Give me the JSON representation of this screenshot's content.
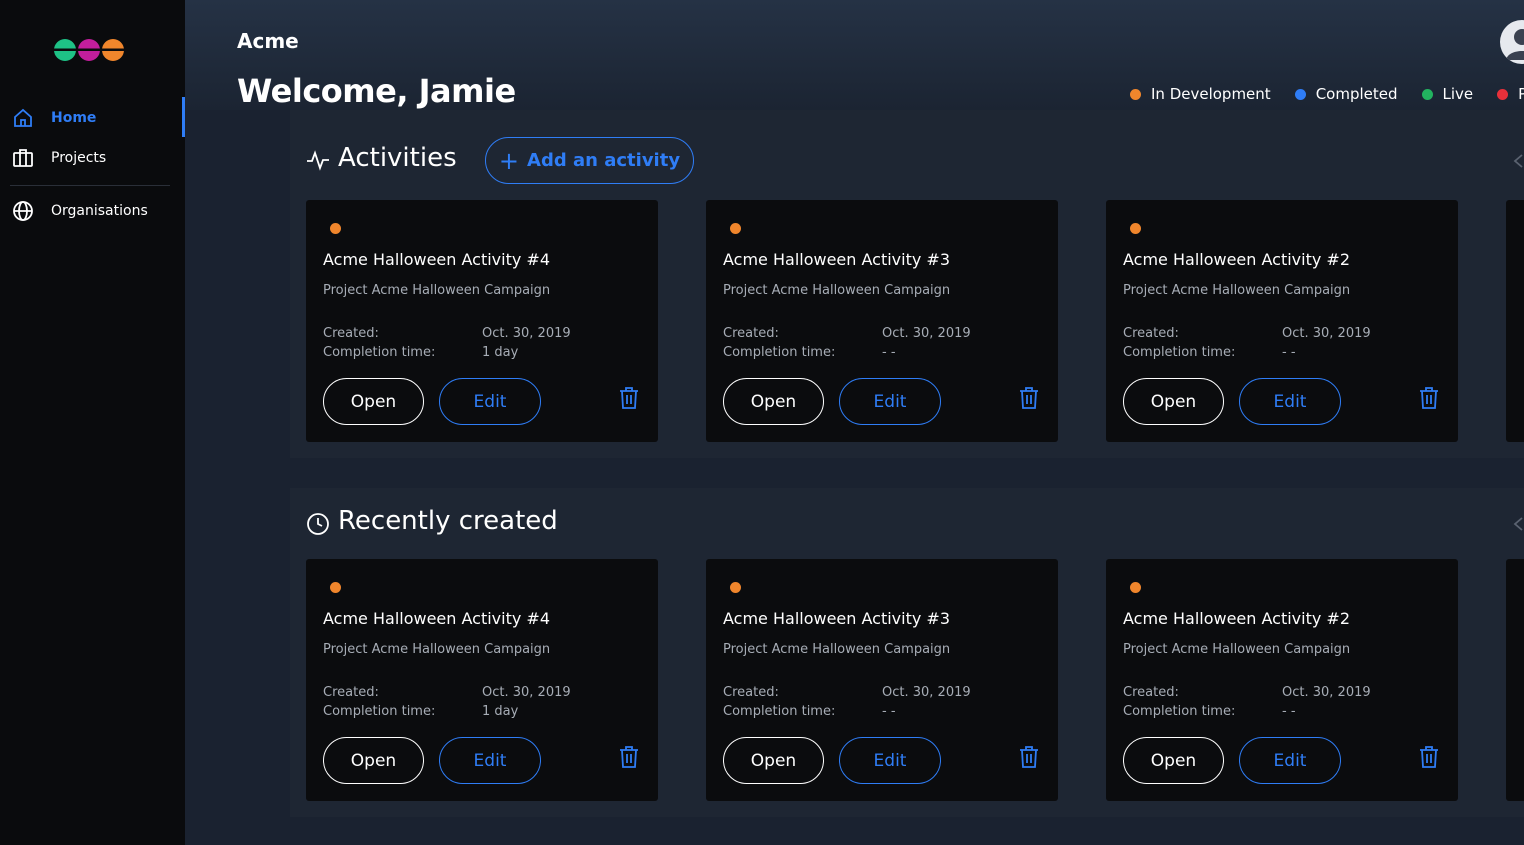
{
  "sidebar": {
    "items": [
      {
        "label": "Home",
        "icon": "home-icon",
        "active": true
      },
      {
        "label": "Projects",
        "icon": "briefcase-icon",
        "active": false
      },
      {
        "label": "Organisations",
        "icon": "globe-icon",
        "active": false
      }
    ]
  },
  "header": {
    "org_name": "Acme",
    "welcome": "Welcome, Jamie"
  },
  "legend": [
    {
      "label": "In Development",
      "color": "#f0862c"
    },
    {
      "label": "Completed",
      "color": "#2f7df6"
    },
    {
      "label": "Live",
      "color": "#22b35f"
    },
    {
      "label": "P",
      "color": "#e8303a"
    }
  ],
  "activities": {
    "title": "Activities",
    "add_label": "Add an activity",
    "cards": [
      {
        "title": "Acme Halloween Activity #4",
        "project": "Project Acme Halloween Campaign",
        "created_label": "Created:",
        "created": "Oct. 30, 2019",
        "completion_label": "Completion time:",
        "completion": "1 day",
        "open_label": "Open",
        "edit_label": "Edit"
      },
      {
        "title": "Acme Halloween Activity #3",
        "project": "Project Acme Halloween Campaign",
        "created_label": "Created:",
        "created": "Oct. 30, 2019",
        "completion_label": "Completion time:",
        "completion": "- -",
        "open_label": "Open",
        "edit_label": "Edit"
      },
      {
        "title": "Acme Halloween Activity #2",
        "project": "Project Acme Halloween Campaign",
        "created_label": "Created:",
        "created": "Oct. 30, 2019",
        "completion_label": "Completion time:",
        "completion": "- -",
        "open_label": "Open",
        "edit_label": "Edit"
      }
    ]
  },
  "recent": {
    "title": "Recently created",
    "cards": [
      {
        "title": "Acme Halloween Activity #4",
        "project": "Project Acme Halloween Campaign",
        "created_label": "Created:",
        "created": "Oct. 30, 2019",
        "completion_label": "Completion time:",
        "completion": "1 day",
        "open_label": "Open",
        "edit_label": "Edit"
      },
      {
        "title": "Acme Halloween Activity #3",
        "project": "Project Acme Halloween Campaign",
        "created_label": "Created:",
        "created": "Oct. 30, 2019",
        "completion_label": "Completion time:",
        "completion": "- -",
        "open_label": "Open",
        "edit_label": "Edit"
      },
      {
        "title": "Acme Halloween Activity #2",
        "project": "Project Acme Halloween Campaign",
        "created_label": "Created:",
        "created": "Oct. 30, 2019",
        "completion_label": "Completion time:",
        "completion": "- -",
        "open_label": "Open",
        "edit_label": "Edit"
      }
    ]
  }
}
